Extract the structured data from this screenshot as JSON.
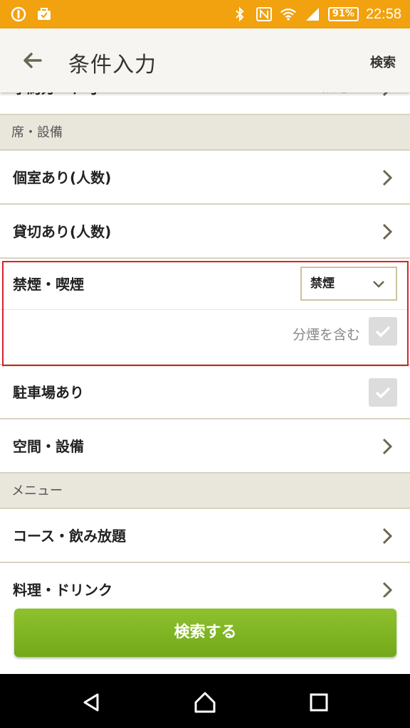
{
  "status_bar": {
    "battery": "91%",
    "time": "22:58",
    "icons_left": [
      "notification-icon",
      "briefcase-icon"
    ],
    "icons_right": [
      "bluetooth-icon",
      "nfc-icon",
      "wifi-icon",
      "signal-icon",
      "battery-icon"
    ]
  },
  "app_bar": {
    "title": "条件入力",
    "action": "検索"
  },
  "list": {
    "partial_row_label": "予約方一ド可",
    "partial_row_value": "指定なし",
    "section_seats": "席・設備",
    "private_room": "個室あり(人数)",
    "charter": "貸切あり(人数)",
    "smoking_label": "禁煙・喫煙",
    "smoking_selected": "禁煙",
    "separated_smoking": "分煙を含む",
    "separated_smoking_checked": true,
    "parking": "駐車場あり",
    "parking_checked": true,
    "space_equipment": "空間・設備",
    "section_menu": "メニュー",
    "course_drinks": "コース・飲み放題",
    "food_drink": "料理・ドリンク"
  },
  "footer": {
    "search_button": "検索する"
  },
  "colors": {
    "status_bar": "#f2a20f",
    "accent_green": "#7db322",
    "highlight": "#d9202a",
    "chevron": "#6b6650"
  }
}
